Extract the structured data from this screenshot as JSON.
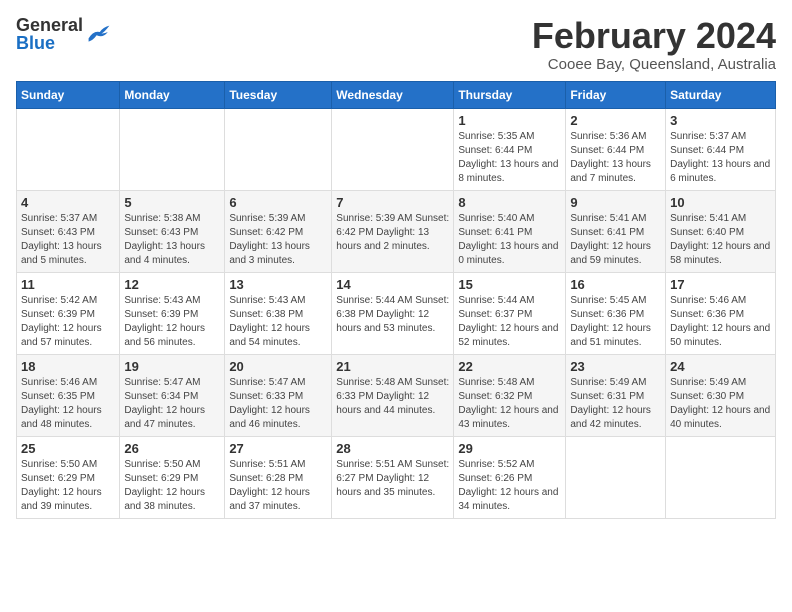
{
  "logo": {
    "general": "General",
    "blue": "Blue"
  },
  "title": "February 2024",
  "subtitle": "Cooee Bay, Queensland, Australia",
  "days_header": [
    "Sunday",
    "Monday",
    "Tuesday",
    "Wednesday",
    "Thursday",
    "Friday",
    "Saturday"
  ],
  "weeks": [
    [
      {
        "num": "",
        "info": ""
      },
      {
        "num": "",
        "info": ""
      },
      {
        "num": "",
        "info": ""
      },
      {
        "num": "",
        "info": ""
      },
      {
        "num": "1",
        "info": "Sunrise: 5:35 AM\nSunset: 6:44 PM\nDaylight: 13 hours\nand 8 minutes."
      },
      {
        "num": "2",
        "info": "Sunrise: 5:36 AM\nSunset: 6:44 PM\nDaylight: 13 hours\nand 7 minutes."
      },
      {
        "num": "3",
        "info": "Sunrise: 5:37 AM\nSunset: 6:44 PM\nDaylight: 13 hours\nand 6 minutes."
      }
    ],
    [
      {
        "num": "4",
        "info": "Sunrise: 5:37 AM\nSunset: 6:43 PM\nDaylight: 13 hours\nand 5 minutes."
      },
      {
        "num": "5",
        "info": "Sunrise: 5:38 AM\nSunset: 6:43 PM\nDaylight: 13 hours\nand 4 minutes."
      },
      {
        "num": "6",
        "info": "Sunrise: 5:39 AM\nSunset: 6:42 PM\nDaylight: 13 hours\nand 3 minutes."
      },
      {
        "num": "7",
        "info": "Sunrise: 5:39 AM\nSunset: 6:42 PM\nDaylight: 13 hours\nand 2 minutes."
      },
      {
        "num": "8",
        "info": "Sunrise: 5:40 AM\nSunset: 6:41 PM\nDaylight: 13 hours\nand 0 minutes."
      },
      {
        "num": "9",
        "info": "Sunrise: 5:41 AM\nSunset: 6:41 PM\nDaylight: 12 hours\nand 59 minutes."
      },
      {
        "num": "10",
        "info": "Sunrise: 5:41 AM\nSunset: 6:40 PM\nDaylight: 12 hours\nand 58 minutes."
      }
    ],
    [
      {
        "num": "11",
        "info": "Sunrise: 5:42 AM\nSunset: 6:39 PM\nDaylight: 12 hours\nand 57 minutes."
      },
      {
        "num": "12",
        "info": "Sunrise: 5:43 AM\nSunset: 6:39 PM\nDaylight: 12 hours\nand 56 minutes."
      },
      {
        "num": "13",
        "info": "Sunrise: 5:43 AM\nSunset: 6:38 PM\nDaylight: 12 hours\nand 54 minutes."
      },
      {
        "num": "14",
        "info": "Sunrise: 5:44 AM\nSunset: 6:38 PM\nDaylight: 12 hours\nand 53 minutes."
      },
      {
        "num": "15",
        "info": "Sunrise: 5:44 AM\nSunset: 6:37 PM\nDaylight: 12 hours\nand 52 minutes."
      },
      {
        "num": "16",
        "info": "Sunrise: 5:45 AM\nSunset: 6:36 PM\nDaylight: 12 hours\nand 51 minutes."
      },
      {
        "num": "17",
        "info": "Sunrise: 5:46 AM\nSunset: 6:36 PM\nDaylight: 12 hours\nand 50 minutes."
      }
    ],
    [
      {
        "num": "18",
        "info": "Sunrise: 5:46 AM\nSunset: 6:35 PM\nDaylight: 12 hours\nand 48 minutes."
      },
      {
        "num": "19",
        "info": "Sunrise: 5:47 AM\nSunset: 6:34 PM\nDaylight: 12 hours\nand 47 minutes."
      },
      {
        "num": "20",
        "info": "Sunrise: 5:47 AM\nSunset: 6:33 PM\nDaylight: 12 hours\nand 46 minutes."
      },
      {
        "num": "21",
        "info": "Sunrise: 5:48 AM\nSunset: 6:33 PM\nDaylight: 12 hours\nand 44 minutes."
      },
      {
        "num": "22",
        "info": "Sunrise: 5:48 AM\nSunset: 6:32 PM\nDaylight: 12 hours\nand 43 minutes."
      },
      {
        "num": "23",
        "info": "Sunrise: 5:49 AM\nSunset: 6:31 PM\nDaylight: 12 hours\nand 42 minutes."
      },
      {
        "num": "24",
        "info": "Sunrise: 5:49 AM\nSunset: 6:30 PM\nDaylight: 12 hours\nand 40 minutes."
      }
    ],
    [
      {
        "num": "25",
        "info": "Sunrise: 5:50 AM\nSunset: 6:29 PM\nDaylight: 12 hours\nand 39 minutes."
      },
      {
        "num": "26",
        "info": "Sunrise: 5:50 AM\nSunset: 6:29 PM\nDaylight: 12 hours\nand 38 minutes."
      },
      {
        "num": "27",
        "info": "Sunrise: 5:51 AM\nSunset: 6:28 PM\nDaylight: 12 hours\nand 37 minutes."
      },
      {
        "num": "28",
        "info": "Sunrise: 5:51 AM\nSunset: 6:27 PM\nDaylight: 12 hours\nand 35 minutes."
      },
      {
        "num": "29",
        "info": "Sunrise: 5:52 AM\nSunset: 6:26 PM\nDaylight: 12 hours\nand 34 minutes."
      },
      {
        "num": "",
        "info": ""
      },
      {
        "num": "",
        "info": ""
      }
    ]
  ]
}
